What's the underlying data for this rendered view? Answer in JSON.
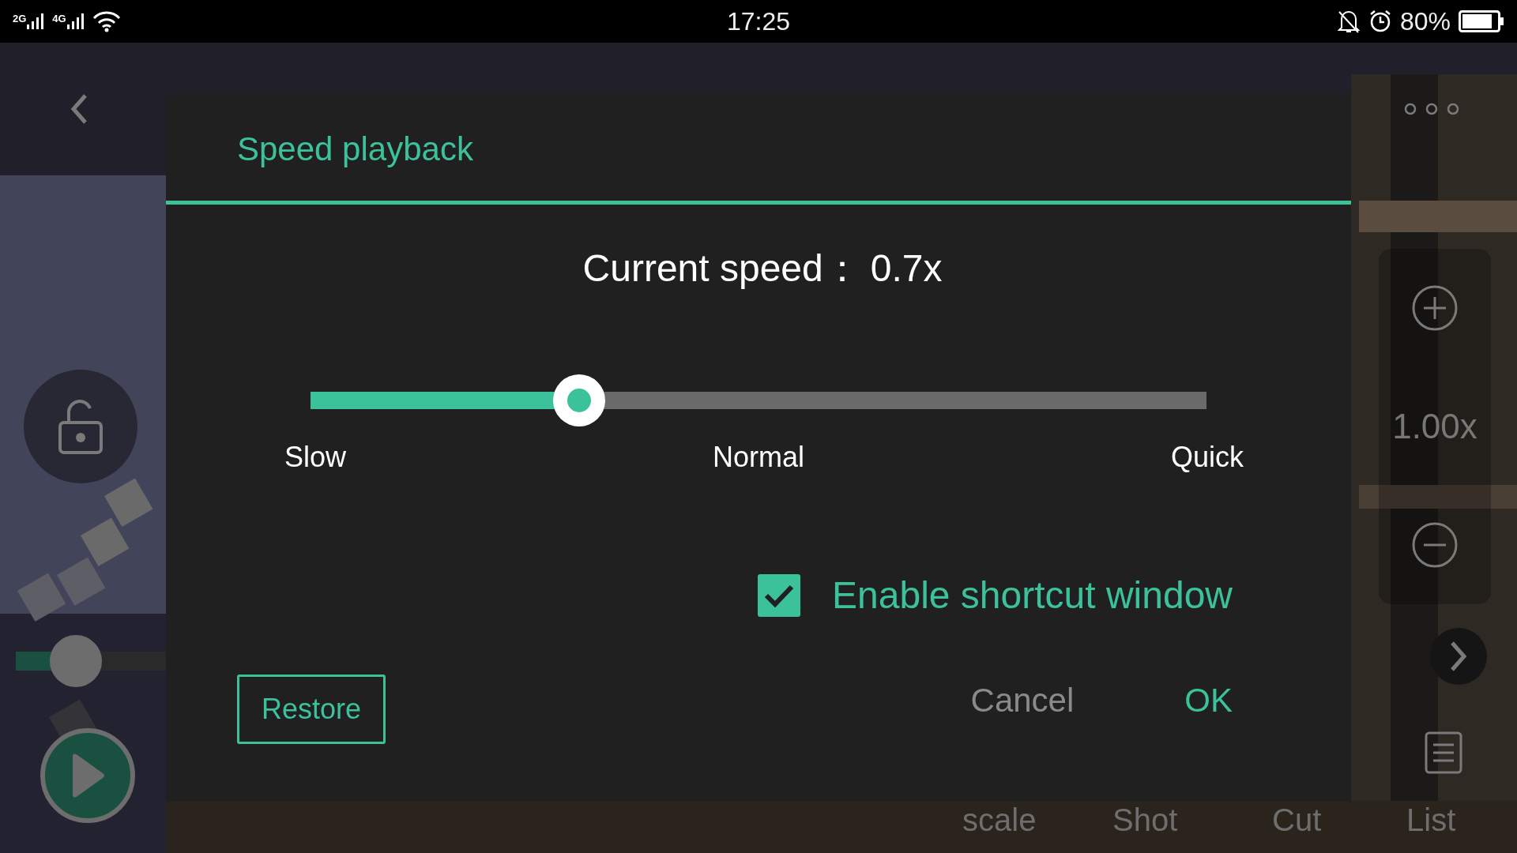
{
  "status_bar": {
    "signal_1": "2G",
    "signal_2": "4G",
    "time": "17:25",
    "battery": "80%"
  },
  "background": {
    "kind": "picture",
    "speed_value": "1.00x",
    "toolbar": [
      "scale",
      "Shot",
      "Cut",
      "List"
    ]
  },
  "dialog": {
    "title": "Speed playback",
    "current_speed": {
      "label": "Current speed：",
      "value": "0.7x"
    },
    "slider": {
      "level": 0.3,
      "labels": [
        "Slow",
        "Normal",
        "Quick"
      ]
    },
    "shortcut": {
      "label": "Enable shortcut window",
      "checked": true
    },
    "buttons": [
      {
        "label": "Restore",
        "kind": "outlined"
      },
      {
        "label": "Cancel",
        "kind": "text"
      },
      {
        "label": "OK",
        "kind": "primary"
      }
    ]
  }
}
